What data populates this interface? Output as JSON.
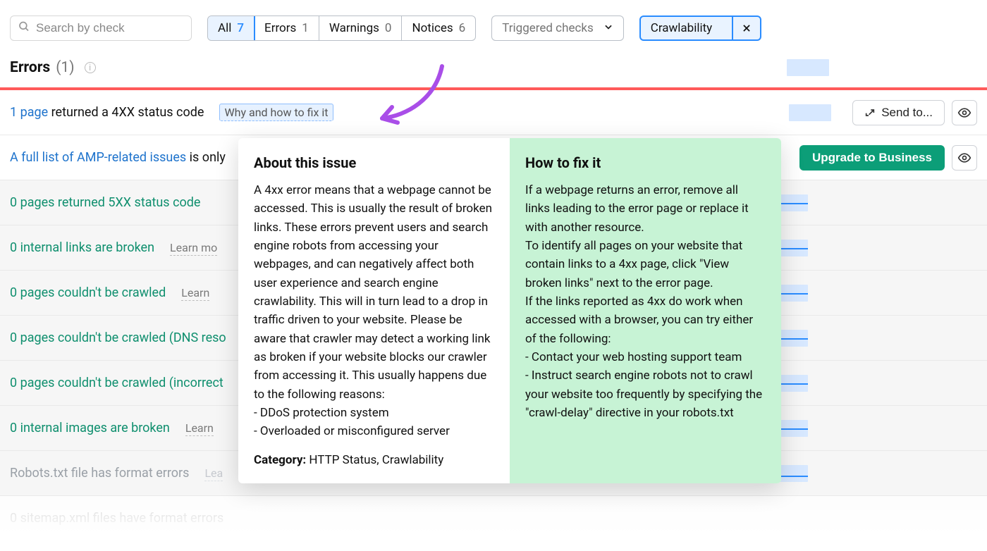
{
  "toolbar": {
    "search_placeholder": "Search by check",
    "tabs": [
      {
        "label": "All",
        "count": "7"
      },
      {
        "label": "Errors",
        "count": "1"
      },
      {
        "label": "Warnings",
        "count": "0"
      },
      {
        "label": "Notices",
        "count": "6"
      }
    ],
    "triggered_label": "Triggered checks",
    "active_filter": "Crawlability"
  },
  "section": {
    "title": "Errors",
    "count": "(1)"
  },
  "rows": {
    "r1_link": "1 page",
    "r1_rest": " returned a 4XX status code",
    "r1_hint": "Why and how to fix it",
    "send_to": "Send to...",
    "r2_link": "A full list of AMP-related issues",
    "r2_rest": " is only",
    "upgrade": "Upgrade to Business",
    "r3": "0 pages returned 5XX status code",
    "r4": "0 internal links are broken",
    "r4_hint": "Learn mo",
    "r5": "0 pages couldn't be crawled",
    "r5_hint": "Learn",
    "r6": "0 pages couldn't be crawled (DNS reso",
    "r7": "0 pages couldn't be crawled (incorrect",
    "r8": "0 internal images are broken",
    "r8_hint": "Learn",
    "r9": "Robots.txt file has format errors",
    "r9_hint": "Lea",
    "r10": "0 sitemap.xml files have format errors"
  },
  "popover": {
    "about_title": "About this issue",
    "about_body": "A 4xx error means that a webpage cannot be accessed. This is usually the result of broken links. These errors prevent users and search engine robots from accessing your webpages, and can negatively affect both user experience and search engine crawlability. This will in turn lead to a drop in traffic driven to your website. Please be aware that crawler may detect a working link as broken if your website blocks our crawler from accessing it. This usually happens due to the following reasons:\n- DDoS protection system\n- Overloaded or misconfigured server",
    "category_label": "Category:",
    "category_value": " HTTP Status, Crawlability",
    "fix_title": "How to fix it",
    "fix_body": "If a webpage returns an error, remove all links leading to the error page or replace it with another resource.\nTo identify all pages on your website that contain links to a 4xx page, click \"View broken links\" next to the error page.\nIf the links reported as 4xx do work when accessed with a browser, you can try either of the following:\n- Contact your web hosting support team\n- Instruct search engine robots not to crawl your website too frequently by specifying the \"crawl-delay\" directive in your robots.txt"
  }
}
